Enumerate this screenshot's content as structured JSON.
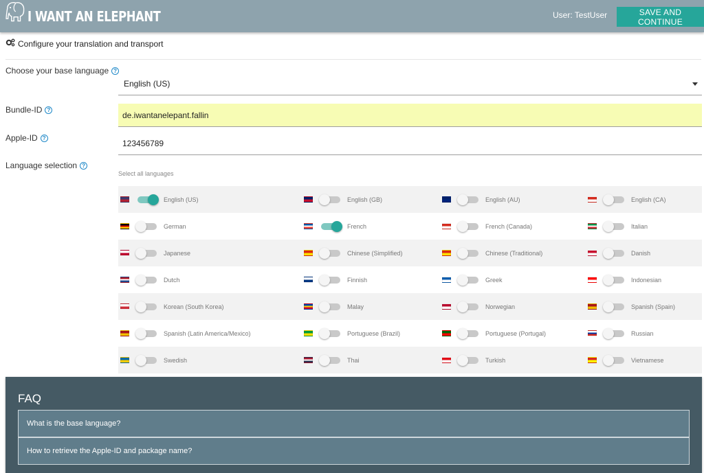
{
  "header": {
    "logo_text": "I WANT AN ELEPHANT",
    "user": "User: TestUser",
    "save_label": "SAVE AND CONTINUE"
  },
  "section_title": "Configure your translation and transport",
  "form": {
    "base_language_label": "Choose your base language",
    "base_language_value": "English (US)",
    "bundle_label": "Bundle-ID",
    "bundle_value": "de.iwantanelepant.fallin",
    "apple_label": "Apple-ID",
    "apple_value": "123456789",
    "language_selection_label": "Language selection",
    "select_all": "Select all languages"
  },
  "languages": [
    [
      {
        "name": "English (US)",
        "on": true,
        "flag": "us-flag",
        "colors": [
          "#3c3b6e",
          "#b22234"
        ]
      },
      {
        "name": "English (GB)",
        "on": false,
        "flag": "gb-flag",
        "colors": [
          "#012169",
          "#c8102e"
        ]
      },
      {
        "name": "English (AU)",
        "on": false,
        "flag": "au-flag",
        "colors": [
          "#012169",
          "#00247d"
        ]
      },
      {
        "name": "English (CA)",
        "on": false,
        "flag": "ca-flag",
        "colors": [
          "#d52b1e",
          "#ffffff"
        ]
      }
    ],
    [
      {
        "name": "German",
        "on": false,
        "flag": "de-flag",
        "colors": [
          "#000000",
          "#dd0000",
          "#ffce00"
        ]
      },
      {
        "name": "French",
        "on": true,
        "flag": "fr-flag",
        "colors": [
          "#0055a4",
          "#ffffff",
          "#ef4135"
        ]
      },
      {
        "name": "French (Canada)",
        "on": false,
        "flag": "ca-flag",
        "colors": [
          "#d52b1e",
          "#ffffff"
        ]
      },
      {
        "name": "Italian",
        "on": false,
        "flag": "it-flag",
        "colors": [
          "#009246",
          "#ffffff",
          "#ce2b37"
        ]
      }
    ],
    [
      {
        "name": "Japanese",
        "on": false,
        "flag": "jp-flag",
        "colors": [
          "#ffffff",
          "#bc002d"
        ]
      },
      {
        "name": "Chinese (Simplified)",
        "on": false,
        "flag": "cn-flag",
        "colors": [
          "#de2910",
          "#ffde00"
        ]
      },
      {
        "name": "Chinese (Traditional)",
        "on": false,
        "flag": "cn-flag",
        "colors": [
          "#de2910",
          "#ffde00"
        ]
      },
      {
        "name": "Danish",
        "on": false,
        "flag": "dk-flag",
        "colors": [
          "#c8102e",
          "#ffffff"
        ]
      }
    ],
    [
      {
        "name": "Dutch",
        "on": false,
        "flag": "nl-flag",
        "colors": [
          "#ae1c28",
          "#ffffff",
          "#21468b"
        ]
      },
      {
        "name": "Finnish",
        "on": false,
        "flag": "fi-flag",
        "colors": [
          "#ffffff",
          "#003580"
        ]
      },
      {
        "name": "Greek",
        "on": false,
        "flag": "gr-flag",
        "colors": [
          "#0d5eaf",
          "#ffffff"
        ]
      },
      {
        "name": "Indonesian",
        "on": false,
        "flag": "id-flag",
        "colors": [
          "#ff0000",
          "#ffffff"
        ]
      }
    ],
    [
      {
        "name": "Korean (South Korea)",
        "on": false,
        "flag": "kr-flag",
        "colors": [
          "#ffffff",
          "#cd2e3a"
        ]
      },
      {
        "name": "Malay",
        "on": false,
        "flag": "md-flag",
        "colors": [
          "#0046ae",
          "#ffd200",
          "#cc092f"
        ]
      },
      {
        "name": "Norwegian",
        "on": false,
        "flag": "no-flag",
        "colors": [
          "#ba0c2f",
          "#ffffff"
        ]
      },
      {
        "name": "Spanish (Spain)",
        "on": false,
        "flag": "es-flag",
        "colors": [
          "#aa151b",
          "#f1bf00"
        ]
      }
    ],
    [
      {
        "name": "Spanish (Latin America/Mexico)",
        "on": false,
        "flag": "es-flag",
        "colors": [
          "#aa151b",
          "#f1bf00"
        ]
      },
      {
        "name": "Portuguese (Brazil)",
        "on": false,
        "flag": "br-flag",
        "colors": [
          "#009c3b",
          "#ffdf00"
        ]
      },
      {
        "name": "Portuguese (Portugal)",
        "on": false,
        "flag": "pt-flag",
        "colors": [
          "#006600",
          "#ff0000"
        ]
      },
      {
        "name": "Russian",
        "on": false,
        "flag": "ru-flag",
        "colors": [
          "#ffffff",
          "#0039a6",
          "#d52b1e"
        ]
      }
    ],
    [
      {
        "name": "Swedish",
        "on": false,
        "flag": "se-flag",
        "colors": [
          "#006aa7",
          "#fecc00"
        ]
      },
      {
        "name": "Thai",
        "on": false,
        "flag": "th-flag",
        "colors": [
          "#a51931",
          "#ffffff",
          "#2d2a4a"
        ]
      },
      {
        "name": "Turkish",
        "on": false,
        "flag": "tr-flag",
        "colors": [
          "#e30a17",
          "#ffffff"
        ]
      },
      {
        "name": "Vietnamese",
        "on": false,
        "flag": "vn-flag",
        "colors": [
          "#da251d",
          "#ffff00"
        ]
      }
    ]
  ],
  "faq": {
    "title": "FAQ",
    "items": [
      "What is the base language?",
      "How to retrieve the Apple-ID and package name?"
    ]
  },
  "colors": {
    "header": "#8ea3ad",
    "accent": "#26a69a",
    "faq_bg": "#455a64",
    "faq_item": "#607d8b",
    "help": "#1e88c8"
  }
}
